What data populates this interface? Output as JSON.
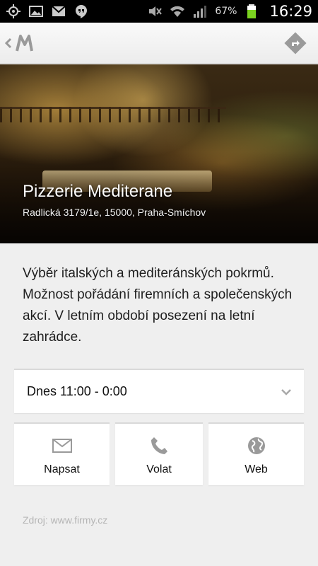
{
  "status_bar": {
    "battery_percent": "67%",
    "time": "16:29",
    "left_icons": [
      "gps-icon",
      "gallery-icon",
      "gmail-icon",
      "hangouts-icon"
    ],
    "right_icons": [
      "mute-icon",
      "wifi-icon",
      "signal-icon",
      "battery-icon"
    ]
  },
  "action_bar": {
    "app_icon": "app-logo-m",
    "right_icon": "directions-icon"
  },
  "place": {
    "name": "Pizzerie Mediterane",
    "address": "Radlická 3179/1e, 15000, Praha-Smíchov",
    "description": "Výběr italských a mediteránských pokrmů. Možnost pořádání firemních a společenských akcí. V letním období posezení na letní zahrádce.",
    "hours": "Dnes 11:00 - 0:00"
  },
  "actions": [
    {
      "label": "Napsat",
      "icon": "mail-icon"
    },
    {
      "label": "Volat",
      "icon": "phone-icon"
    },
    {
      "label": "Web",
      "icon": "globe-icon"
    }
  ],
  "source": "Zdroj: www.firmy.cz",
  "colors": {
    "status_bar_bg": "#000000",
    "action_bar_bg": "#f4f4f4",
    "page_bg": "#efefef",
    "card_bg": "#ffffff",
    "icon_gray": "#9a9a9a",
    "battery_green": "#7bd320"
  }
}
